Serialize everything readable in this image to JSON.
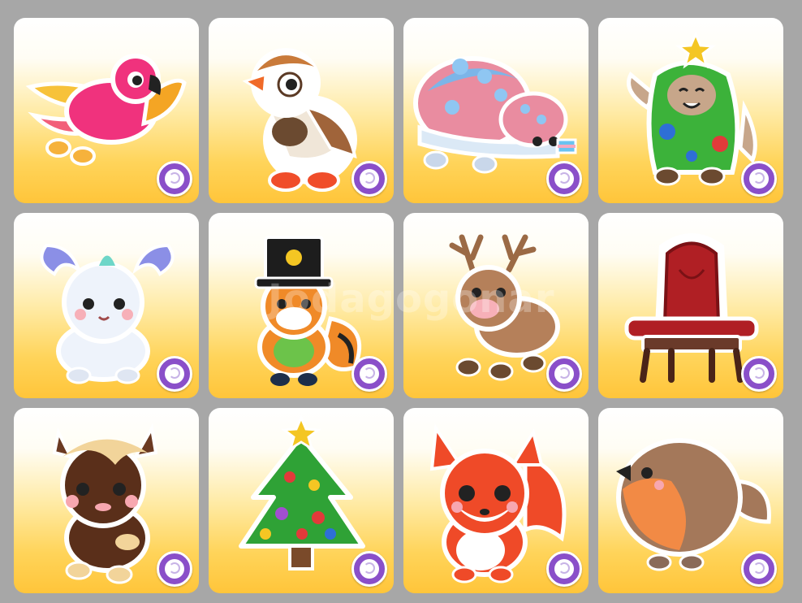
{
  "watermark": "Jodagogonar",
  "colors": {
    "background": "#a7a7a7",
    "tile_top": "#ffffff",
    "tile_bottom": "#ffc53a",
    "rarity_badge": "#8a4fc9"
  },
  "grid": {
    "columns": 4,
    "rows": 3,
    "tiles": [
      {
        "subject": "parrot",
        "badge": "rarity-badge-icon"
      },
      {
        "subject": "puffin",
        "badge": "rarity-badge-icon"
      },
      {
        "subject": "snail-pair",
        "badge": "rarity-badge-icon"
      },
      {
        "subject": "tree-costume-sloth",
        "badge": "rarity-badge-icon"
      },
      {
        "subject": "winter-fox",
        "badge": "rarity-badge-icon"
      },
      {
        "subject": "hat-fox",
        "badge": "rarity-badge-icon"
      },
      {
        "subject": "reindeer",
        "badge": "rarity-badge-icon"
      },
      {
        "subject": "throne",
        "badge": "rarity-badge-icon"
      },
      {
        "subject": "pony",
        "badge": "rarity-badge-icon"
      },
      {
        "subject": "christmas-tree",
        "badge": "rarity-badge-icon"
      },
      {
        "subject": "red-fox",
        "badge": "rarity-badge-icon"
      },
      {
        "subject": "robin",
        "badge": "rarity-badge-icon"
      }
    ]
  }
}
